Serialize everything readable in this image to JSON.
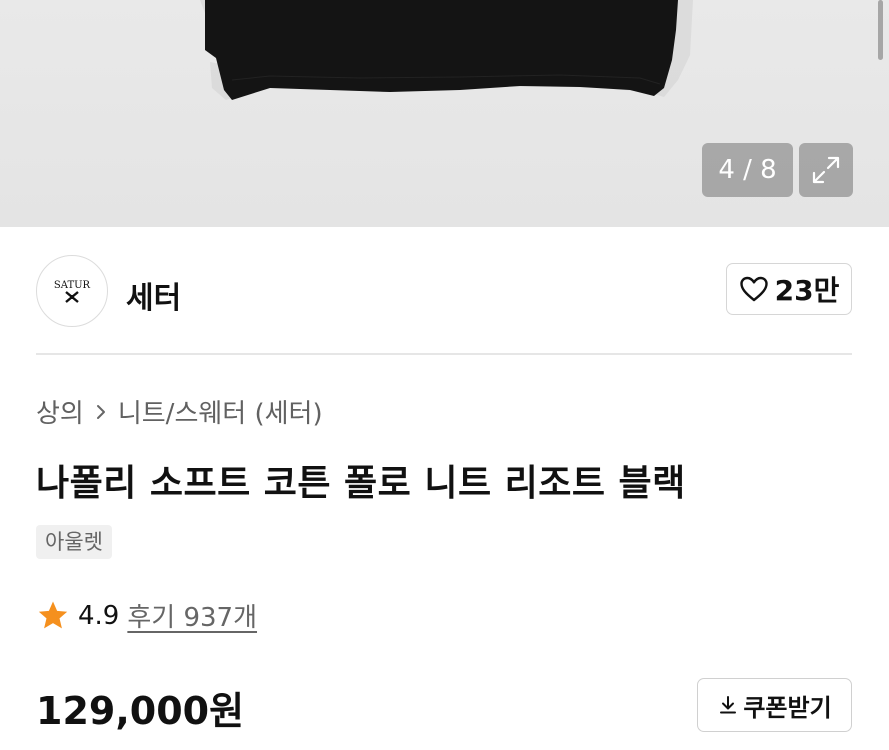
{
  "gallery": {
    "counter": "4 / 8",
    "expand_icon": "expand-icon"
  },
  "brand": {
    "logo_text": "SATUR",
    "name": "세터",
    "likes": "23만",
    "like_icon": "heart-outline-icon"
  },
  "breadcrumb": {
    "category": "상의",
    "subcategory": "니트/스웨터 (세터)",
    "separator_icon": "chevron-right-icon"
  },
  "product": {
    "title": "나폴리 소프트 코튼 폴로 니트 리조트 블랙",
    "tag": "아울렛",
    "rating": "4.9",
    "reviews": "후기 937개",
    "price": "129,000원",
    "star_color": "#f5901e"
  },
  "coupon": {
    "label": "쿠폰받기",
    "icon": "download-icon"
  }
}
